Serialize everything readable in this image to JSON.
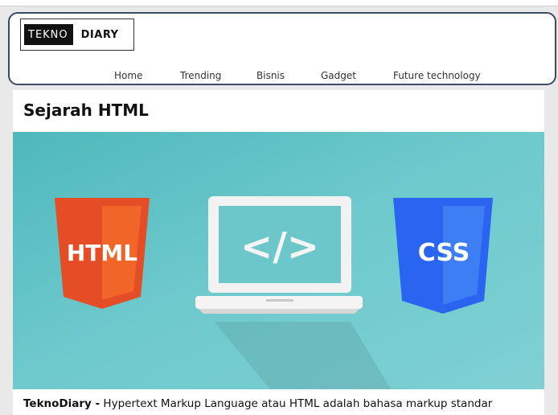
{
  "logo": {
    "part1": "TEKNO",
    "part2": "DIARY"
  },
  "nav": [
    {
      "label": "Home"
    },
    {
      "label": "Trending"
    },
    {
      "label": "Bisnis"
    },
    {
      "label": "Gadget"
    },
    {
      "label": "Future technology"
    }
  ],
  "article": {
    "title": "Sejarah HTML",
    "hero": {
      "badge_html": "HTML",
      "code_symbol": "</>",
      "badge_css": "CSS"
    },
    "lead_bold": "TeknoDiary -",
    "lead_text": " Hypertext Markup Language atau HTML adalah bahasa markup standar"
  },
  "colors": {
    "header_border": "#3c4a66",
    "hero_bg": "#6cc7cb",
    "html_orange": "#e44d26",
    "css_blue": "#2965f1"
  }
}
